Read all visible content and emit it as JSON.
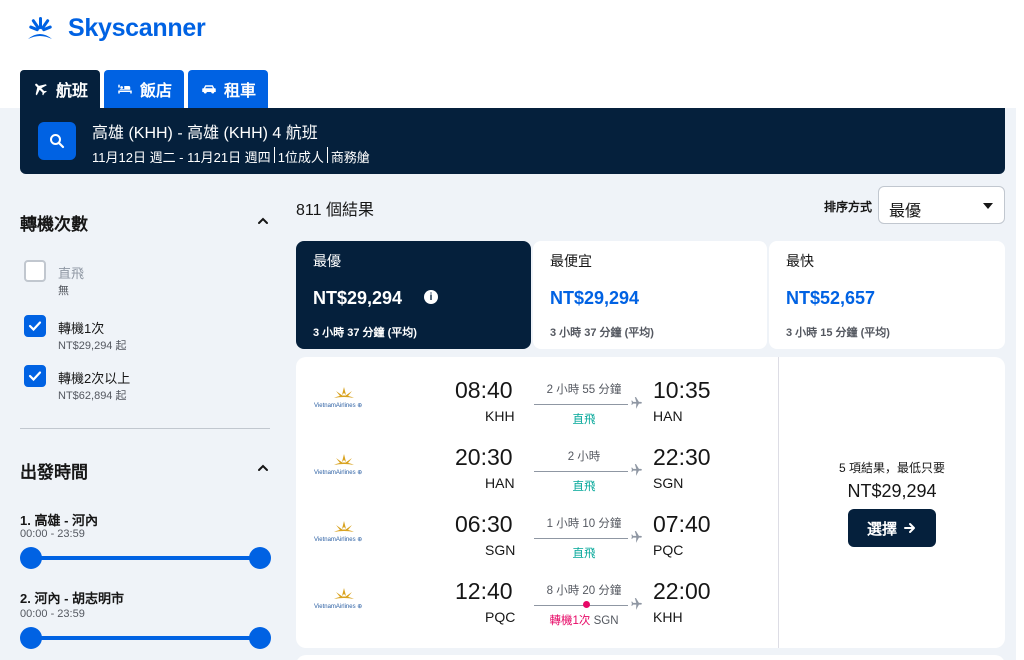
{
  "brand": {
    "name": "Skyscanner",
    "color": "#0062e3",
    "dark": "#05203c"
  },
  "tabs": [
    {
      "label": "航班",
      "icon": "plane-icon",
      "active": true
    },
    {
      "label": "飯店",
      "icon": "bed-icon",
      "active": false
    },
    {
      "label": "租車",
      "icon": "car-icon",
      "active": false
    }
  ],
  "search": {
    "title": "高雄 (KHH) - 高雄 (KHH) 4 航班",
    "dates": "11月12日 週二 - 11月21日 週四",
    "travellers": "1位成人",
    "cabin": "商務艙"
  },
  "filters": {
    "stops": {
      "heading": "轉機次數",
      "options": [
        {
          "label": "直飛",
          "sub": "無",
          "checked": false,
          "disabled": true
        },
        {
          "label": "轉機1次",
          "sub": "NT$29,294 起",
          "checked": true,
          "disabled": false
        },
        {
          "label": "轉機2次以上",
          "sub": "NT$62,894 起",
          "checked": true,
          "disabled": false
        }
      ]
    },
    "departure_times": {
      "heading": "出發時間",
      "ranges": [
        {
          "label": "1. 高雄 - 河內",
          "range": "00:00 - 23:59"
        },
        {
          "label": "2. 河內 - 胡志明市",
          "range": "00:00 - 23:59"
        }
      ]
    }
  },
  "results": {
    "count": "811 個結果",
    "sort_label": "排序方式",
    "sort_value": "最優",
    "sort_tabs": [
      {
        "title": "最優",
        "price": "NT$29,294",
        "duration": "3 小時 37 分鐘 (平均)",
        "active": true
      },
      {
        "title": "最便宜",
        "price": "NT$29,294",
        "duration": "3 小時 37 分鐘 (平均)",
        "active": false
      },
      {
        "title": "最快",
        "price": "NT$52,657",
        "duration": "3 小時 15 分鐘 (平均)",
        "active": false
      }
    ]
  },
  "itinerary": {
    "airline": "Vietnam Airlines",
    "legs": [
      {
        "dep_time": "08:40",
        "dep_code": "KHH",
        "arr_time": "10:35",
        "arr_code": "HAN",
        "duration": "2 小時 55 分鐘",
        "stops": "直飛",
        "via": ""
      },
      {
        "dep_time": "20:30",
        "dep_code": "HAN",
        "arr_time": "22:30",
        "arr_code": "SGN",
        "duration": "2 小時",
        "stops": "直飛",
        "via": ""
      },
      {
        "dep_time": "06:30",
        "dep_code": "SGN",
        "arr_time": "07:40",
        "arr_code": "PQC",
        "duration": "1 小時 10 分鐘",
        "stops": "直飛",
        "via": ""
      },
      {
        "dep_time": "12:40",
        "dep_code": "PQC",
        "arr_time": "22:00",
        "arr_code": "KHH",
        "duration": "8 小時 20 分鐘",
        "stops": "轉機1次",
        "via": "SGN"
      }
    ],
    "deals_note": "5 項結果，最低只要",
    "price": "NT$29,294",
    "select_label": "選擇"
  }
}
